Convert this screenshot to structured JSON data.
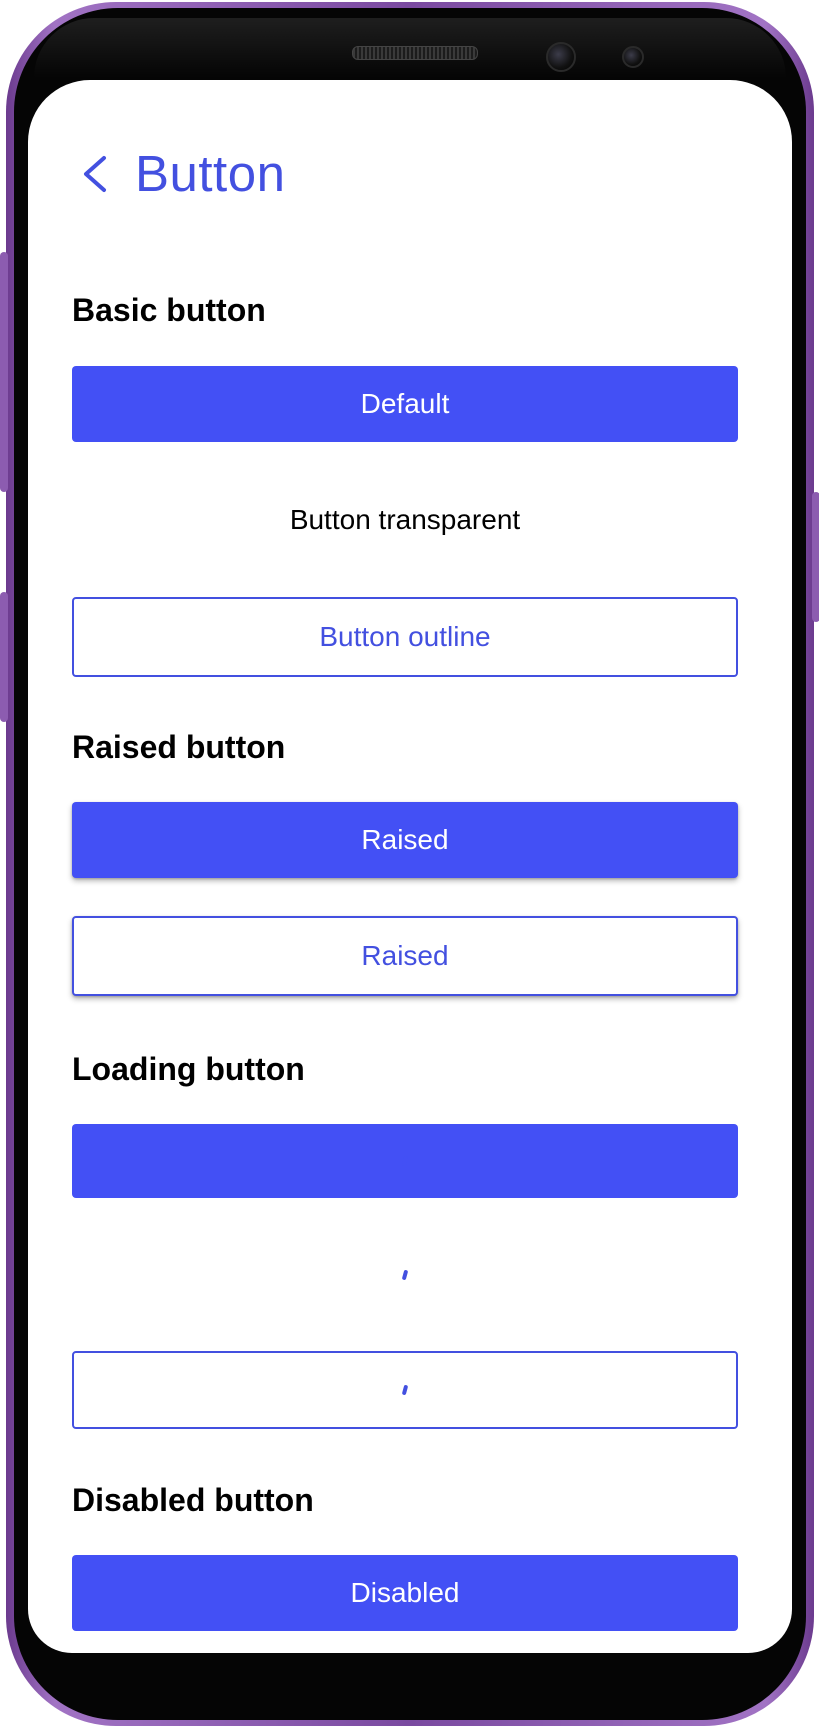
{
  "header": {
    "title": "Button",
    "accent_color": "#4350e0"
  },
  "sections": {
    "basic": {
      "title": "Basic button",
      "default_label": "Default",
      "transparent_label": "Button transparent",
      "outline_label": "Button outline"
    },
    "raised": {
      "title": "Raised button",
      "fill_label": "Raised",
      "outline_label": "Raised"
    },
    "loading": {
      "title": "Loading button"
    },
    "disabled": {
      "title": "Disabled button",
      "label": "Disabled"
    }
  },
  "colors": {
    "primary": "#4350f5",
    "device_frame": "#8c5cb0"
  }
}
